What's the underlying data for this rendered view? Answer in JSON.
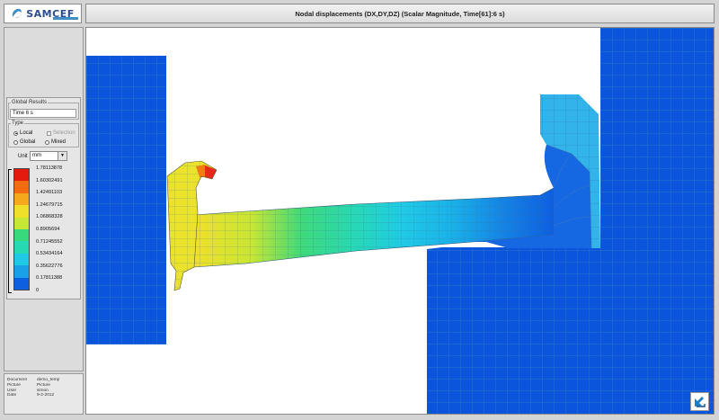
{
  "app": {
    "logo_text": "SAMCEF",
    "title": "Nodal displacements (DX,DY,DZ) (Scalar Magnitude, Time[61]:6 s)"
  },
  "global_results": {
    "group_label": "Global Results",
    "time_label": "Time",
    "time_value": "6 s"
  },
  "type_group": {
    "group_label": "Type",
    "local_label": "Local",
    "selection_label": "Selection",
    "global_label": "Global",
    "mixed_label": "Mixed",
    "selected": "Local"
  },
  "unit": {
    "label": "Unit",
    "value": "mm"
  },
  "color_scale": {
    "labels": [
      "1.78113878",
      "1.60302491",
      "1.42491103",
      "1.24679715",
      "1.06868328",
      "0.8905694",
      "0.71245552",
      "0.53434164",
      "0.35622776",
      "0.17811388",
      "0"
    ],
    "colors": [
      "#e41a0f",
      "#f26b10",
      "#f5a81c",
      "#f0df2a",
      "#c5e634",
      "#37d97c",
      "#26d9b3",
      "#1fc9e6",
      "#1aa0e6",
      "#0e5ee0"
    ]
  },
  "info": {
    "rows": [
      {
        "key": "Document",
        "value": "demo_temp"
      },
      {
        "key": "Picture",
        "value": "Picture"
      },
      {
        "key": "User",
        "value": "simon"
      },
      {
        "key": "Date",
        "value": "9-2-2012"
      }
    ]
  },
  "colors": {
    "deep_blue": "#0a55dc",
    "mesh_line": "#2f6fb0",
    "accent": "#2a4d8f"
  }
}
